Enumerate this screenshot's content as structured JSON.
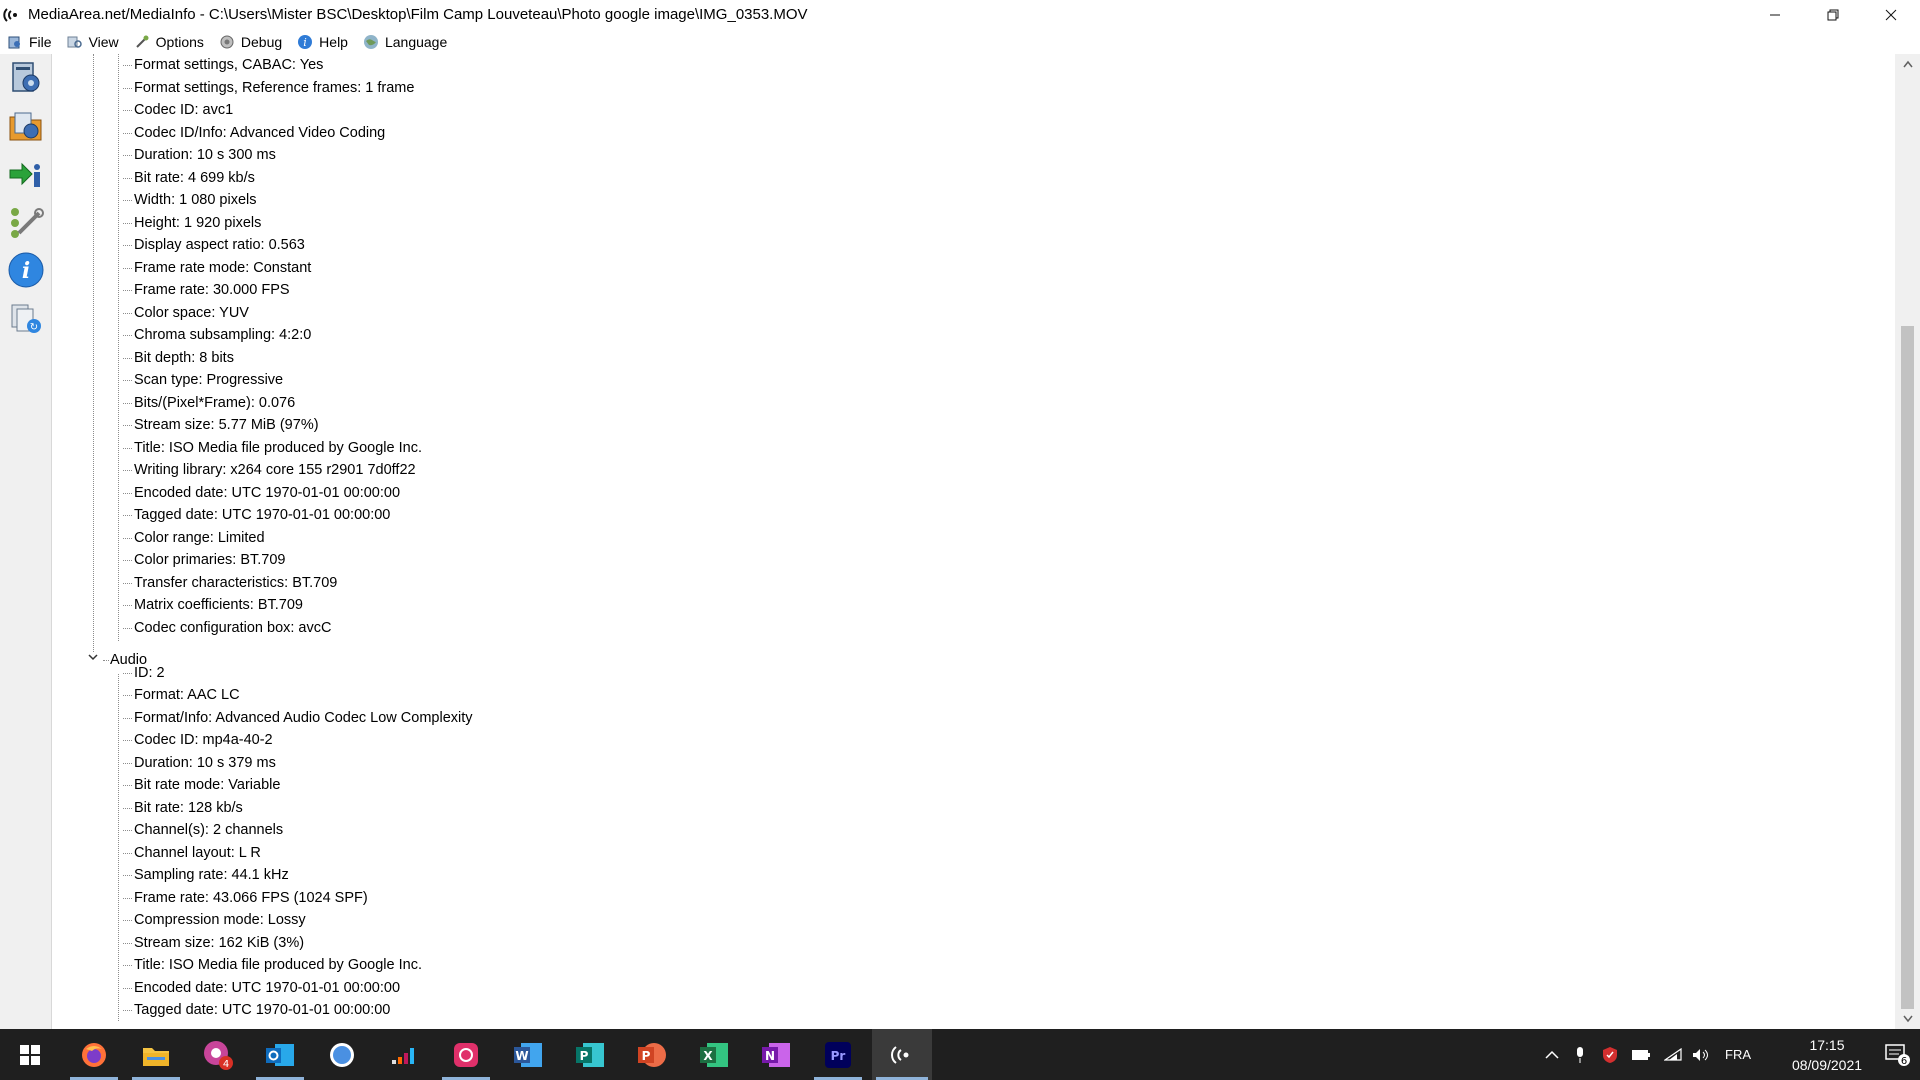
{
  "window": {
    "title": "MediaArea.net/MediaInfo - C:\\Users\\Mister BSC\\Desktop\\Film Camp Louveteau\\Photo google image\\IMG_0353.MOV",
    "app_icon": "mediainfo-icon",
    "controls": [
      "minimize-icon",
      "restore-icon",
      "close-icon"
    ]
  },
  "menu": [
    {
      "label": "File",
      "icon": "file-menu-icon"
    },
    {
      "label": "View",
      "icon": "view-menu-icon"
    },
    {
      "label": "Options",
      "icon": "options-menu-icon"
    },
    {
      "label": "Debug",
      "icon": "debug-menu-icon"
    },
    {
      "label": "Help",
      "icon": "help-menu-icon"
    },
    {
      "label": "Language",
      "icon": "language-menu-icon"
    }
  ],
  "toolbar": [
    "open-file-icon",
    "open-folder-icon",
    "export-icon",
    "preferences-icon",
    "about-icon",
    "knowledge-icon"
  ],
  "video_items": [
    "Format settings, CABAC: Yes",
    "Format settings, Reference frames: 1 frame",
    "Codec ID: avc1",
    "Codec ID/Info: Advanced Video Coding",
    "Duration: 10 s 300 ms",
    "Bit rate: 4 699 kb/s",
    "Width: 1 080 pixels",
    "Height: 1 920 pixels",
    "Display aspect ratio: 0.563",
    "Frame rate mode: Constant",
    "Frame rate: 30.000 FPS",
    "Color space: YUV",
    "Chroma subsampling: 4:2:0",
    "Bit depth: 8 bits",
    "Scan type: Progressive",
    "Bits/(Pixel*Frame): 0.076",
    "Stream size: 5.77 MiB (97%)",
    "Title: ISO Media file produced by Google Inc.",
    "Writing library: x264 core 155 r2901 7d0ff22",
    "Encoded date: UTC 1970-01-01 00:00:00",
    "Tagged date: UTC 1970-01-01 00:00:00",
    "Color range: Limited",
    "Color primaries: BT.709",
    "Transfer characteristics: BT.709",
    "Matrix coefficients: BT.709",
    "Codec configuration box: avcC"
  ],
  "audio_node": {
    "label": "Audio",
    "expander": "chevron-down-icon"
  },
  "audio_items": [
    "ID: 2",
    "Format: AAC LC",
    "Format/Info: Advanced Audio Codec Low Complexity",
    "Codec ID: mp4a-40-2",
    "Duration: 10 s 379 ms",
    "Bit rate mode: Variable",
    "Bit rate: 128 kb/s",
    "Channel(s): 2 channels",
    "Channel layout: L R",
    "Sampling rate: 44.1 kHz",
    "Frame rate: 43.066 FPS (1024 SPF)",
    "Compression mode: Lossy",
    "Stream size: 162 KiB (3%)",
    "Title: ISO Media file produced by Google Inc.",
    "Encoded date: UTC 1970-01-01 00:00:00",
    "Tagged date: UTC 1970-01-01 00:00:00"
  ],
  "scrollbar": {
    "position_fraction": 0.27,
    "visible_fraction": 0.73
  },
  "taskbar": {
    "apps": [
      {
        "name": "start-icon",
        "color": "#ffffff"
      },
      {
        "name": "firefox-icon",
        "color": "#ff7139"
      },
      {
        "name": "file-explorer-icon",
        "color": "#f5c342"
      },
      {
        "name": "chrome-icon",
        "color": "#c8459a",
        "badge": "4"
      },
      {
        "name": "outlook-icon",
        "color": "#0f6cbd"
      },
      {
        "name": "messenger-icon",
        "color": "#4a90e2"
      },
      {
        "name": "deezer-icon",
        "color": "#e0e0e0"
      },
      {
        "name": "photo-app-icon",
        "color": "#e0306a"
      },
      {
        "name": "word-icon",
        "color": "#2b579a",
        "letter": "W"
      },
      {
        "name": "publisher-icon",
        "color": "#077568",
        "letter": "P"
      },
      {
        "name": "powerpoint-icon",
        "color": "#d04423",
        "letter": "P"
      },
      {
        "name": "excel-icon",
        "color": "#1d6f42",
        "letter": "X"
      },
      {
        "name": "onenote-icon",
        "color": "#7719aa",
        "letter": "N"
      },
      {
        "name": "premiere-pro-icon",
        "color": "#00005b",
        "letter": "Pr"
      },
      {
        "name": "mediainfo-taskbar-icon",
        "color": "#ffffff"
      }
    ],
    "tray": {
      "icons": [
        "show-hidden-icons-chevron",
        "microphone-icon",
        "antivirus-icon",
        "battery-icon",
        "wifi-icon",
        "volume-icon"
      ],
      "language": "FRA",
      "time": "17:15",
      "date": "08/09/2021",
      "notifications": "6"
    }
  }
}
